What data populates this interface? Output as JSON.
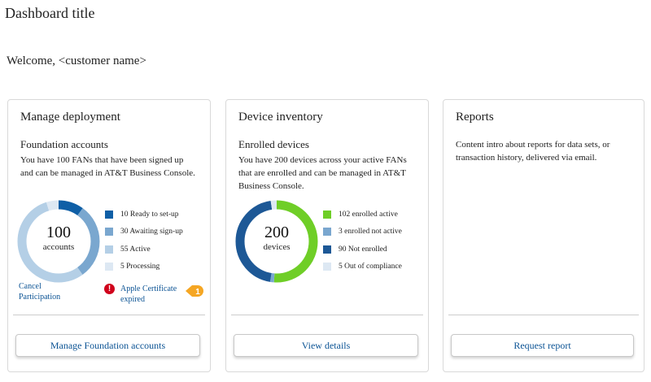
{
  "dashboard_title": "Dashboard title",
  "welcome": "Welcome, <customer name>",
  "colors": {
    "link": "#0b5394",
    "alert": "#d0021b",
    "badge": "#f5a623",
    "card_border": "#d9d9d9"
  },
  "cards": [
    {
      "title": "Manage deployment",
      "subtitle": "Foundation accounts",
      "intro": "You have 100 FANs that have been signed up and can be managed in AT&T Business Console.",
      "donut": {
        "value": "100",
        "unit": "accounts",
        "segments": [
          {
            "label": "10 Ready to set-up",
            "value": 10,
            "color": "#0f5fa6"
          },
          {
            "label": "30  Awaiting sign-up",
            "value": 30,
            "color": "#7aa7cf"
          },
          {
            "label": "55 Active",
            "value": 55,
            "color": "#b4cfe6"
          },
          {
            "label": "5 Processing",
            "value": 5,
            "color": "#dde8f3"
          }
        ]
      },
      "cancel_link": "Cancel Participation",
      "alert_link": "Apple Certificate expired",
      "alert_icon": "exclamation-icon",
      "badge_count": "1",
      "button": "Manage Foundation accounts"
    },
    {
      "title": "Device inventory",
      "subtitle": "Enrolled devices",
      "intro": "You have 200 devices across your active FANs that are enrolled and can be managed in AT&T Business Console.",
      "donut": {
        "value": "200",
        "unit": "devices",
        "segments": [
          {
            "label": "102 enrolled active",
            "value": 102,
            "color": "#6fce27"
          },
          {
            "label": "3 enrolled not active",
            "value": 3,
            "color": "#7aa7cf"
          },
          {
            "label": "90 Not enrolled",
            "value": 90,
            "color": "#1d5896"
          },
          {
            "label": "5 Out of compliance",
            "value": 5,
            "color": "#dde8f3"
          }
        ]
      },
      "button": "View details"
    },
    {
      "title": "Reports",
      "intro": "Content intro about reports for data sets, or transaction history, delivered via email.",
      "button": "Request report"
    }
  ]
}
